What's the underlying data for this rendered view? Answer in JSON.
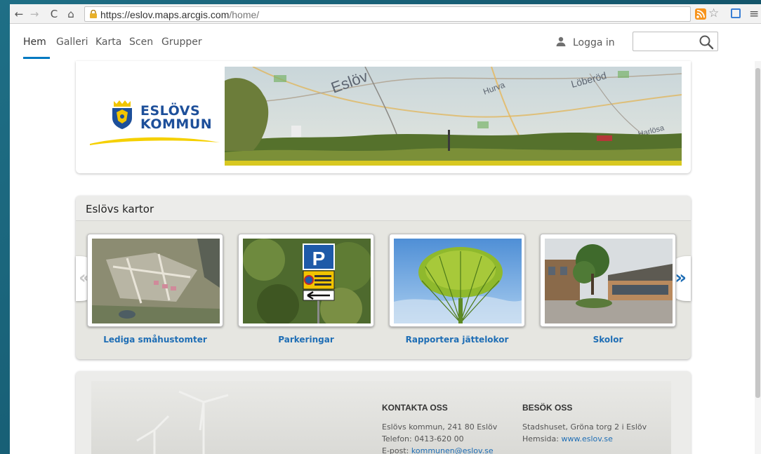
{
  "browser": {
    "url_host": "https://eslov.maps.arcgis.com",
    "url_path": "/home/"
  },
  "nav": {
    "items": [
      "Hem",
      "Galleri",
      "Karta",
      "Scen",
      "Grupper"
    ],
    "login": "Logga in",
    "search_placeholder": ""
  },
  "banner": {
    "logo_line1": "ESLÖVS",
    "logo_line2": "KOMMUN",
    "map_labels": [
      "Eslöv",
      "Löberöd",
      "Hurva",
      "Harlösa"
    ]
  },
  "gallery": {
    "title": "Eslövs kartor",
    "items": [
      {
        "label": "Lediga småhustomter"
      },
      {
        "label": "Parkeringar"
      },
      {
        "label": "Rapportera jättelokor"
      },
      {
        "label": "Skolor"
      }
    ],
    "sign_letter": "P"
  },
  "footer": {
    "contact_heading": "KONTAKTA OSS",
    "contact_address": "Eslövs kommun, 241 80 Eslöv",
    "contact_phone": "Telefon: 0413-620 00",
    "contact_email_prefix": "E-post: ",
    "contact_email": "kommunen@eslov.se",
    "visit_heading": "BESÖK OSS",
    "visit_address": "Stadshuset, Gröna torg 2 i Eslöv",
    "visit_web_prefix": "Hemsida: ",
    "visit_web": "www.eslov.se"
  },
  "colors": {
    "accent": "#1f6eb5",
    "nav_active": "#0079c1",
    "logo_blue": "#1d4f9a",
    "logo_yellow": "#f5d000"
  }
}
